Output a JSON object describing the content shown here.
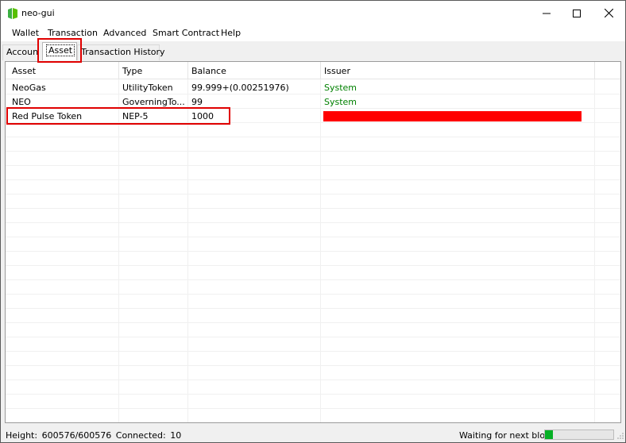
{
  "window": {
    "title": "neo-gui",
    "icon": "neo-logo-icon",
    "controls": [
      "minimize-icon",
      "maximize-icon",
      "close-icon"
    ]
  },
  "menu": [
    "Wallet",
    "Transaction",
    "Advanced",
    "Smart Contract",
    "Help"
  ],
  "tabs": [
    {
      "label": "Account",
      "selected": false
    },
    {
      "label": "Asset",
      "selected": true
    },
    {
      "label": "Transaction History",
      "selected": false
    }
  ],
  "table": {
    "columns": [
      "Asset",
      "Type",
      "Balance",
      "Issuer"
    ],
    "rows": [
      {
        "asset": "NeoGas",
        "type": "UtilityToken",
        "balance": "99.999+(0.00251976)",
        "issuer": "System"
      },
      {
        "asset": "NEO",
        "type": "GoverningTo...",
        "balance": "99",
        "issuer": "System"
      },
      {
        "asset": "Red Pulse Token",
        "type": "NEP-5",
        "balance": "1000",
        "issuer": ""
      }
    ]
  },
  "status": {
    "height_label": "Height:",
    "height_value": "600576/600576",
    "connected_label": "Connected:",
    "connected_value": "10",
    "waiting_label": "Waiting for next block:",
    "progress_fraction": 0.12
  },
  "colors": {
    "issuer_text": "#008000",
    "redaction": "#ff0000",
    "annotation": "#e00000",
    "progress": "#06b025"
  }
}
